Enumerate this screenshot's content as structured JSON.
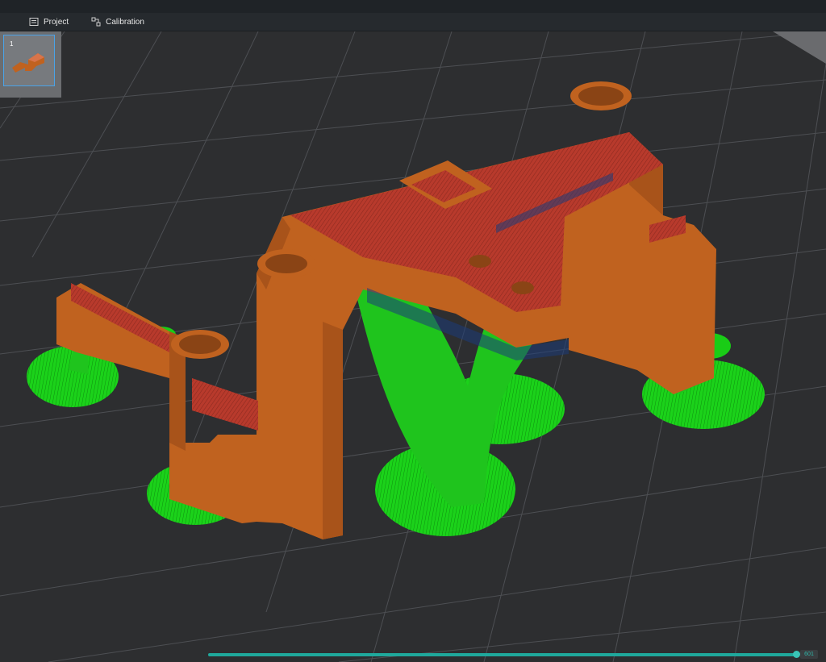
{
  "menubar": {
    "items": [
      {
        "label": "Project",
        "icon": "project-icon"
      },
      {
        "label": "Calibration",
        "icon": "calibration-icon"
      }
    ]
  },
  "plate_list": {
    "items": [
      {
        "number": "1"
      }
    ]
  },
  "layer_slider": {
    "value": "601",
    "progress": 1.0,
    "color": "#1fa89c"
  },
  "colors": {
    "model": "#c0621f",
    "top_surface": "#b83a2c",
    "support": "#19cc16",
    "grid": "#505256",
    "background": "#2d2e30"
  }
}
